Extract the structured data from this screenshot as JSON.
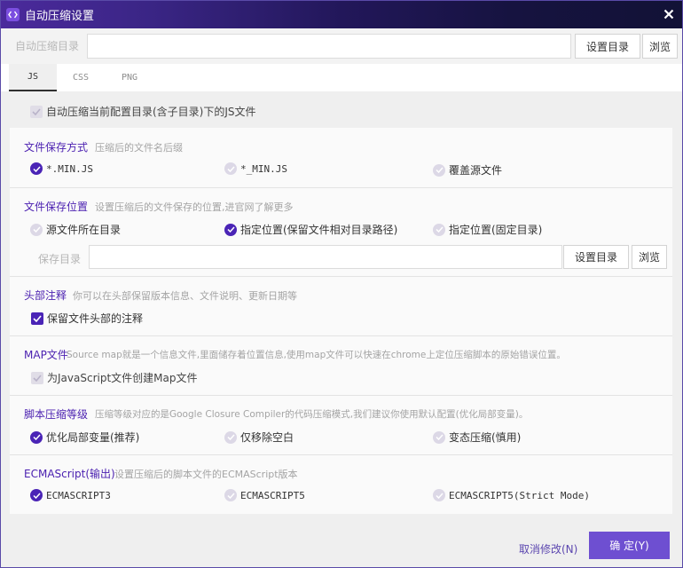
{
  "window": {
    "title": "自动压缩设置"
  },
  "dir_row": {
    "label": "自动压缩目录",
    "input_value": "",
    "set_dir_label": "设置目录",
    "browse_label": "浏览"
  },
  "tabs": [
    {
      "label": "JS",
      "active": true
    },
    {
      "label": "CSS",
      "active": false
    },
    {
      "label": "PNG",
      "active": false
    }
  ],
  "auto_compress": {
    "label": "自动压缩当前配置目录(含子目录)下的JS文件",
    "checked": true,
    "disabled": true
  },
  "file_save_mode": {
    "title": "文件保存方式",
    "desc": "压缩后的文件名后缀",
    "options": [
      {
        "label": "*.MIN.JS",
        "selected": true
      },
      {
        "label": "*_MIN.JS",
        "selected": false
      },
      {
        "label": "覆盖源文件",
        "selected": false
      }
    ]
  },
  "file_save_location": {
    "title": "文件保存位置",
    "desc": "设置压缩后的文件保存的位置,进官网了解更多",
    "options": [
      {
        "label": "源文件所在目录",
        "selected": false
      },
      {
        "label": "指定位置(保留文件相对目录路径)",
        "selected": true
      },
      {
        "label": "指定位置(固定目录)",
        "selected": false
      }
    ],
    "save_dir_label": "保存目录",
    "save_dir_value": "",
    "set_dir_label": "设置目录",
    "browse_label": "浏览"
  },
  "header_comment": {
    "title": "头部注释",
    "desc": "你可以在头部保留版本信息、文件说明、更新日期等",
    "option": {
      "label": "保留文件头部的注释",
      "checked": true
    }
  },
  "map_file": {
    "title": "MAP文件",
    "desc": "Source map就是一个信息文件,里面储存着位置信息,使用map文件可以快速在chrome上定位压缩脚本的原始错误位置。",
    "option": {
      "label": "为JavaScript文件创建Map文件",
      "checked": true,
      "disabled": true
    }
  },
  "compress_level": {
    "title": "脚本压缩等级",
    "desc": "压缩等级对应的是Google Closure Compiler的代码压缩模式,我们建议你使用默认配置(优化局部变量)。",
    "options": [
      {
        "label": "优化局部变量(推荐)",
        "selected": true
      },
      {
        "label": "仅移除空白",
        "selected": false
      },
      {
        "label": "变态压缩(慎用)",
        "selected": false
      }
    ]
  },
  "ecmascript": {
    "title": "ECMAScript(输出)",
    "desc": "设置压缩后的脚本文件的ECMAScript版本",
    "options": [
      {
        "label": "ECMASCRIPT3",
        "selected": true
      },
      {
        "label": "ECMASCRIPT5",
        "selected": false
      },
      {
        "label": "ECMASCRIPT5(Strict Mode)",
        "selected": false
      }
    ]
  },
  "footer": {
    "cancel_label": "取消修改(N)",
    "ok_label": "确 定(Y)"
  },
  "colors": {
    "accent": "#4a24b6",
    "section_title": "#4a1fb0",
    "ok_button": "#6e4fd1",
    "titlebar_start": "#4b2a9c",
    "titlebar_end": "#121236"
  },
  "icons": {
    "app": "code-brackets-icon",
    "close": "close-icon",
    "radio_selected": "radio-checked-icon",
    "radio_unselected": "radio-unchecked-icon",
    "checkbox_checked": "checkbox-checked-icon"
  }
}
